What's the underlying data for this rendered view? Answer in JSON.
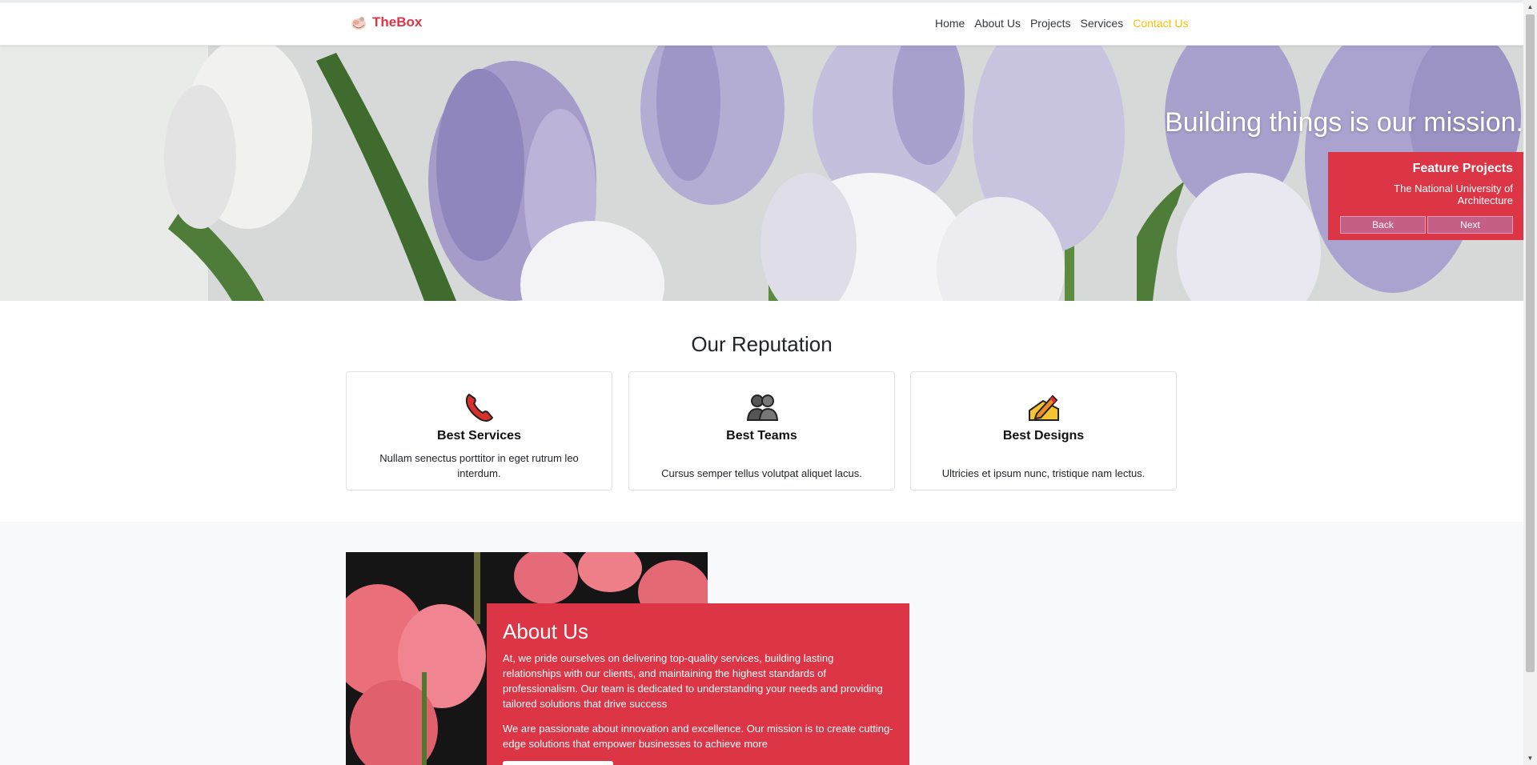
{
  "navbar": {
    "brand": "TheBox",
    "links": [
      "Home",
      "About Us",
      "Projects",
      "Services",
      "Contact Us"
    ],
    "active_index": 4
  },
  "hero": {
    "title": "Building things is our mission.",
    "feature": {
      "title": "Feature Projects",
      "subtitle": "The National University of Architecture",
      "back_label": "Back",
      "next_label": "Next"
    }
  },
  "reputation": {
    "title": "Our Reputation",
    "cards": [
      {
        "icon": "telephone-icon",
        "title": "Best Services",
        "text": "Nullam senectus porttitor in eget rutrum leo interdum."
      },
      {
        "icon": "people-icon",
        "title": "Best Teams",
        "text": "Cursus semper tellus volutpat aliquet lacus."
      },
      {
        "icon": "pencil-icon",
        "title": "Best Designs",
        "text": "Ultricies et ipsum nunc, tristique nam lectus."
      }
    ]
  },
  "about": {
    "title": "About Us",
    "paragraphs": [
      "At, we pride ourselves on delivering top-quality services, building lasting relationships with our clients, and maintaining the highest standards of professionalism. Our team is dedicated to understanding your needs and providing tailored solutions that drive success",
      "We are passionate about innovation and excellence. Our mission is to create cutting-edge solutions that empower businesses to achieve more"
    ]
  },
  "colors": {
    "brand": "#dc3545",
    "nav_active": "#ffc107",
    "text": "#212529",
    "section_bg": "#f8f9fa"
  }
}
